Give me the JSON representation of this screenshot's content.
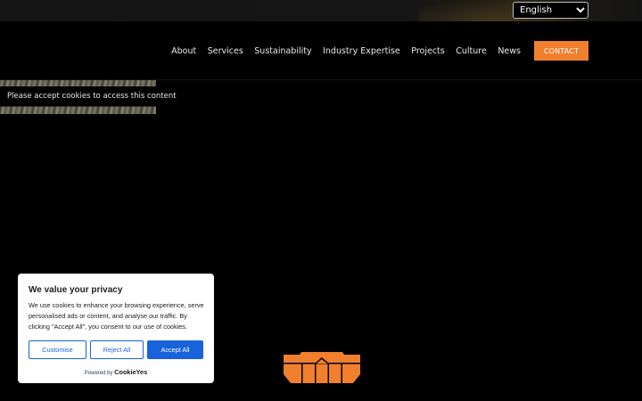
{
  "top_bar": {
    "language": {
      "selected": "English"
    }
  },
  "nav": {
    "items": [
      "About",
      "Services",
      "Sustainability",
      "Industry Expertise",
      "Projects",
      "Culture",
      "News"
    ],
    "contact_label": "CONTACT"
  },
  "cookie_placeholder": {
    "text": "Please accept cookies to access this content"
  },
  "consent": {
    "title": "We value your privacy",
    "description": "We use cookies to enhance your browsing experience, serve personalised ads or content, and analyse our traffic. By clicking \"Accept All\", you consent to our use of cookies.",
    "customise_label": "Customise",
    "reject_label": "Reject All",
    "accept_label": "Accept All",
    "powered_by": "Powered by",
    "powered_brand": "CookieYes"
  },
  "colors": {
    "accent_orange": "#f07f2e",
    "consent_blue": "#1863dc",
    "background": "#000000"
  }
}
